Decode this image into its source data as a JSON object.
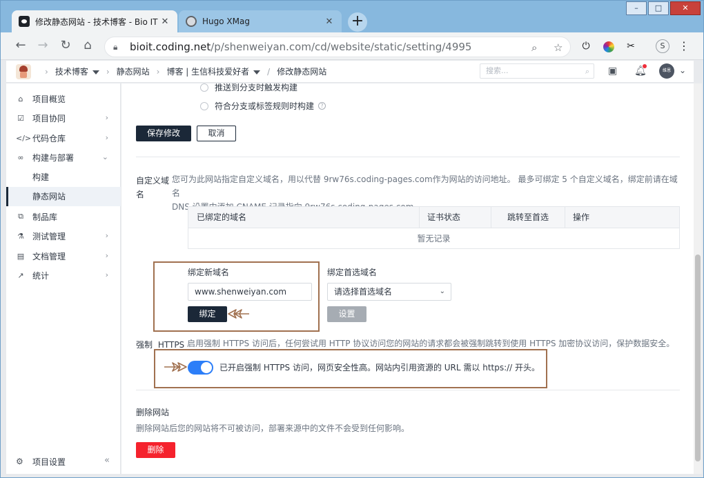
{
  "browser": {
    "tabs": [
      {
        "title": "修改静态网站 - 技术博客 - Bio IT",
        "close": "✕"
      },
      {
        "title": "Hugo XMag",
        "close": "✕"
      }
    ],
    "new_tab": "+",
    "url_host": "bioit.coding.net",
    "url_path": "/p/shenweiyan.com/cd/website/static/setting/4995",
    "profile_initial": "S",
    "window_buttons": {
      "minimize": "–",
      "maximize": "□",
      "close": "✕"
    }
  },
  "app_header": {
    "breadcrumbs": [
      "技术博客",
      "静态网站",
      "博客 | 生信科技爱好者",
      "修改静态网站"
    ],
    "search_placeholder": "搜索...",
    "avatar_text": "维恩"
  },
  "sidebar": {
    "items": [
      {
        "label": "项目概览",
        "icon": "home-icon",
        "chevron": ""
      },
      {
        "label": "项目协同",
        "icon": "checkbox-icon",
        "chevron": "›"
      },
      {
        "label": "代码仓库",
        "icon": "code-icon",
        "chevron": "›"
      },
      {
        "label": "构建与部署",
        "icon": "infinity-icon",
        "chevron": "⌄"
      }
    ],
    "sub_items": [
      {
        "label": "构建",
        "active": false
      },
      {
        "label": "静态网站",
        "active": true
      }
    ],
    "items_after": [
      {
        "label": "制品库",
        "icon": "package-icon",
        "chevron": ""
      },
      {
        "label": "测试管理",
        "icon": "flask-icon",
        "chevron": "›"
      },
      {
        "label": "文档管理",
        "icon": "document-icon",
        "chevron": "›"
      },
      {
        "label": "统计",
        "icon": "chart-icon",
        "chevron": "›"
      }
    ],
    "footer": {
      "label": "项目设置",
      "collapse": "«"
    }
  },
  "main": {
    "radio_options": [
      "推送到分支时触发构建",
      "符合分支或标签规则时构建"
    ],
    "save_button": "保存修改",
    "cancel_button": "取消",
    "custom_domain": {
      "label_line1": "自定义域",
      "label_line2": "名",
      "desc_line1": "您可为此网站指定自定义域名，用以代替 9rw76s.coding-pages.com作为网站的访问地址。 最多可绑定 5 个自定义域名，绑定前请在域名",
      "desc_line2": "DNS 设置中添加 CNAME 记录指向 9rw76s.coding-pages.com",
      "table_headers": [
        "已绑定的域名",
        "证书状态",
        "跳转至首选",
        "操作"
      ],
      "empty_text": "暂无记录",
      "bind_new_label": "绑定新域名",
      "bind_new_value": "www.shenweiyan.com",
      "bind_button": "绑定",
      "preferred_label": "绑定首选域名",
      "preferred_placeholder": "请选择首选域名",
      "set_button": "设置"
    },
    "https": {
      "label_a": "强制",
      "label_b": "HTTPS",
      "desc": "启用强制 HTTPS 访问后，任何尝试用 HTTP 协议访问您的网站的请求都会被强制跳转到使用 HTTPS 加密协议访问，保护数据安全。",
      "enabled": true,
      "status_text": "已开启强制 HTTPS 访问，网页安全性高。网站内引用资源的 URL 需以 https:// 开头。"
    },
    "delete": {
      "title": "删除网站",
      "desc": "删除网站后您的网站将不可被访问，部署来源中的文件不会受到任何影响。",
      "button": "删除"
    }
  },
  "colors": {
    "primary_dark": "#1b2838",
    "toggle_on": "#2c7ef8",
    "danger": "#f5222d",
    "annotation": "#a0704f",
    "tabstrip": "#87b8de"
  }
}
